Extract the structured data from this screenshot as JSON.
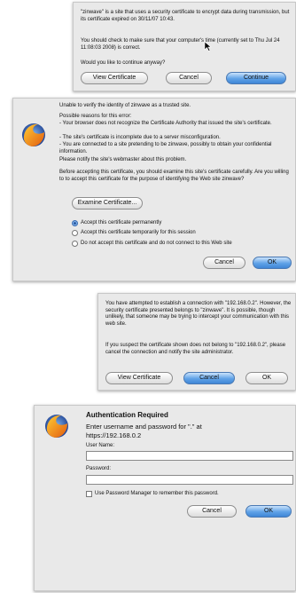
{
  "dialog1": {
    "message": "\"zinwave\" is a site that uses a security certificate to encrypt data during transmission, but its certificate expired on 30/11/07 10:43.",
    "advice": "You should check to make sure that your computer's time (currently set to Thu Jul 24 11:08:03 2008) is correct.",
    "question": "Would you like to continue anyway?",
    "view_label": "View Certificate",
    "cancel_label": "Cancel",
    "continue_label": "Continue"
  },
  "dialog2": {
    "heading": "Unable to verify the identity of zinwave as a trusted site.",
    "reasons_title": "Possible reasons for this error:",
    "reason_1": "- Your browser does not recognize the Certificate Authority that issued the site's certificate.",
    "reason_2": "- The site's certificate is incomplete due to a server misconfiguration.",
    "reason_3": "- You are connected to a site pretending to be zinwave, possibly to obtain your confidential information.",
    "notify": "Please notify the site's webmaster about this problem.",
    "before": "Before accepting this certificate, you should examine this site's certificate carefully. Are you willing to to accept this certificate for the purpose of identifying the Web site zinwave?",
    "examine_label": "Examine Certificate...",
    "option_permanent": "Accept this certificate permanently",
    "option_session": "Accept this certificate temporarily for this session",
    "option_reject": "Do not accept this certificate and do not connect to this Web site",
    "cancel_label": "Cancel",
    "ok_label": "OK"
  },
  "dialog3": {
    "message": "You have attempted to establish a connection with \"192.168.0.2\". However, the security certificate presented belongs to \"zinwave\". It is possible, though unlikely, that someone may be trying to intercept your communication with this web site.",
    "advice": "If you suspect the certificate shown does not belong to \"192.168.0.2\", please cancel the connection and notify the site administrator.",
    "view_label": "View Certificate",
    "cancel_label": "Cancel",
    "ok_label": "OK"
  },
  "dialog4": {
    "title": "Authentication Required",
    "prompt": "Enter username and password for \".\" at https://192.168.0.2",
    "username_label": "User Name:",
    "password_label": "Password:",
    "remember_label": "Use Password Manager to remember this password.",
    "cancel_label": "Cancel",
    "ok_label": "OK"
  }
}
